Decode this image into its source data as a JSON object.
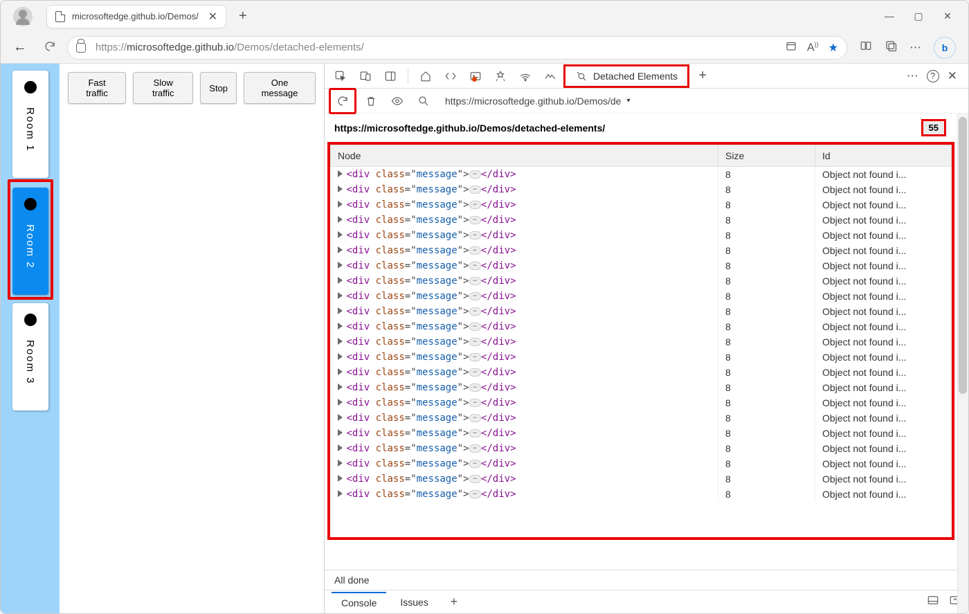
{
  "browser": {
    "tab_title": "microsoftedge.github.io/Demos/",
    "url_prefix": "https://",
    "url_host": "microsoftedge.github.io",
    "url_path": "/Demos/detached-elements/"
  },
  "app": {
    "rooms": [
      "Room 1",
      "Room 2",
      "Room 3"
    ],
    "active_room_index": 1,
    "buttons": [
      "Fast traffic",
      "Slow traffic",
      "Stop",
      "One message"
    ]
  },
  "devtools": {
    "active_tab": "Detached Elements",
    "sub_url": "https://microsoftedge.github.io/Demos/de",
    "source_url": "https://microsoftedge.github.io/Demos/detached-elements/",
    "count": "55",
    "columns": [
      "Node",
      "Size",
      "Id"
    ],
    "rows_count": 22,
    "row_node_html": {
      "open_tag": "<div",
      "attr_name": " class",
      "eq": "=\"",
      "attr_val": "message",
      "eq_close": "\">",
      "close_tag": "</div>"
    },
    "row_size": "8",
    "row_id": "Object not found i...",
    "status": "All done",
    "drawer_tabs": [
      "Console",
      "Issues"
    ]
  }
}
